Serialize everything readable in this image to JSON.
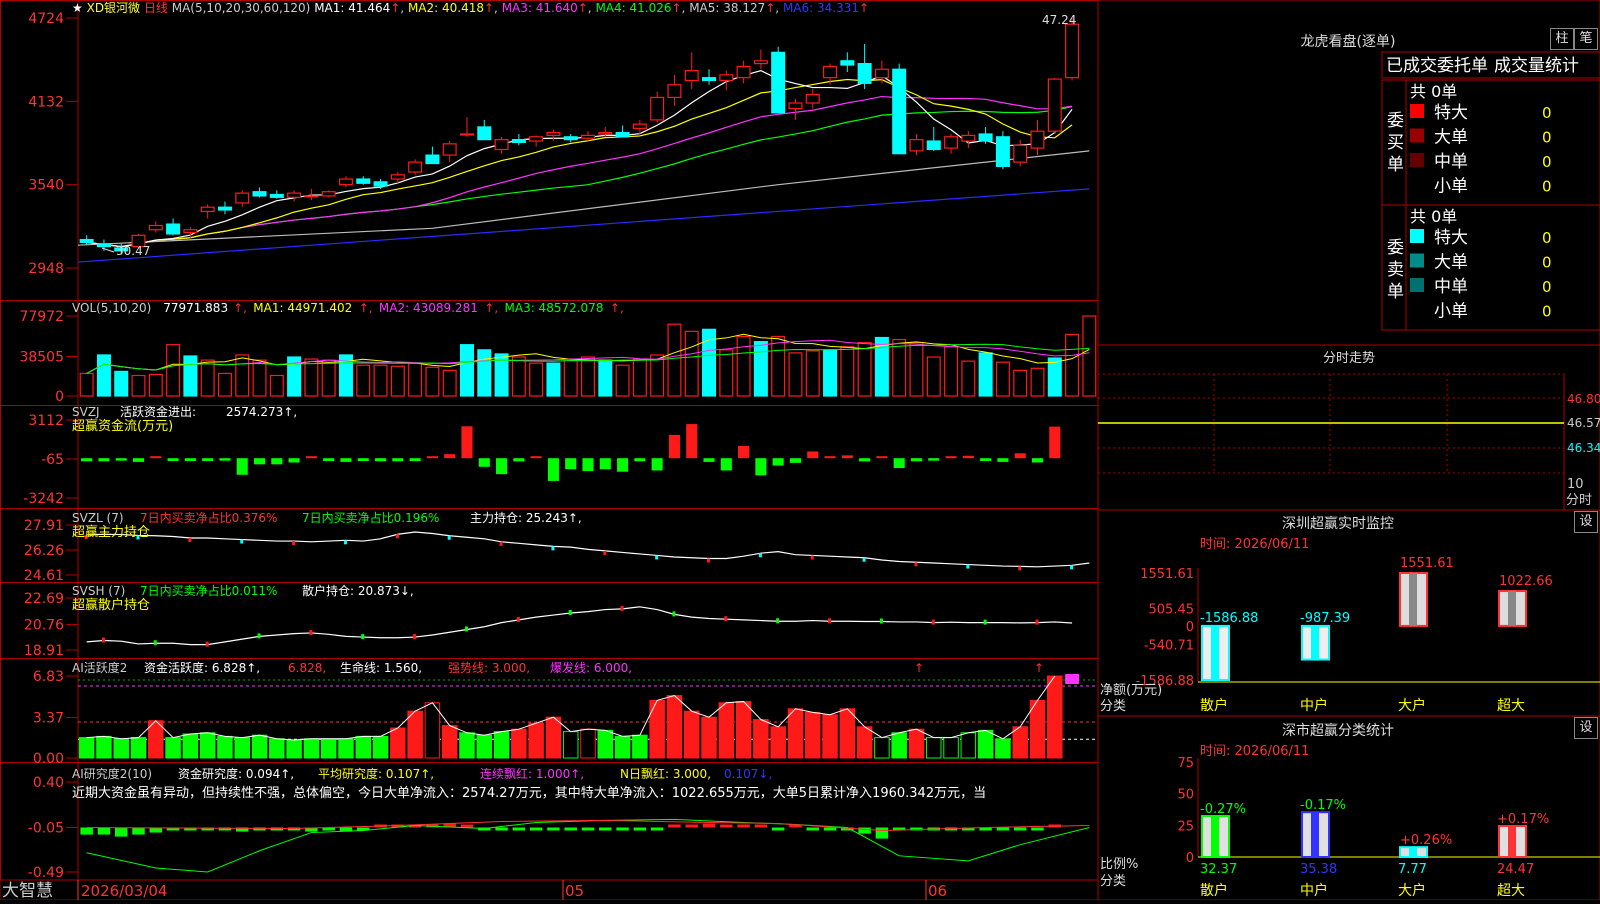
{
  "colors": {
    "up": "#ff1a1a",
    "down": "#00ffff",
    "green": "#00ff00",
    "ma1": "#ffffff",
    "ma2": "#ffff00",
    "ma3": "#ff33ff",
    "ma4": "#00ff00",
    "ma5": "#bbbbbb",
    "ma6": "#2b2bff",
    "frame": "#b00000"
  },
  "header": {
    "star": "★",
    "name": "XD银河微",
    "period": "日线",
    "ma_params": "MA(5,10,20,30,60,120)",
    "ma_items": [
      {
        "label": "MA1: 41.464",
        "arrow": "↑"
      },
      {
        "label": "MA2: 40.418",
        "arrow": "↑"
      },
      {
        "label": "MA3: 41.640",
        "arrow": "↑"
      },
      {
        "label": "MA4: 41.026",
        "arrow": "↑"
      },
      {
        "label": "MA5: 38.127",
        "arrow": "↑"
      },
      {
        "label": "MA6: 34.331",
        "arrow": "↑"
      }
    ]
  },
  "price_panel": {
    "y_ticks": [
      "4724",
      "4132",
      "3540",
      "2948"
    ],
    "high_label": "47.24",
    "low_label": "30.47"
  },
  "vol_panel": {
    "title": "VOL(5,10,20)",
    "value": "77971.883",
    "ma1": "MA1: 44971.402",
    "ma2": "MA2: 43089.281",
    "ma3": "MA3: 48572.078",
    "y_ticks": [
      "77972",
      "38505",
      "0"
    ]
  },
  "svzj_panel": {
    "title": "SVZJ",
    "label": "活跃资金进出:",
    "value": "2574.273",
    "subtitle": "超赢资金流(万元)",
    "y_ticks": [
      "3112",
      "-65",
      "-3242"
    ]
  },
  "svzl_panel": {
    "title": "SVZL (7)",
    "t1": "7日内买卖净占比0.376%",
    "t2": "7日内买卖净占比0.196%",
    "t3": "主力持仓: 25.243",
    "subtitle": "超赢主力持仓",
    "y_ticks": [
      "27.91",
      "26.26",
      "24.61"
    ]
  },
  "svsh_panel": {
    "title": "SVSH (7)",
    "t1": "7日内买卖净占比0.011%",
    "t2": "散户持仓: 20.873",
    "subtitle": "超赢散户持仓",
    "y_ticks": [
      "22.69",
      "20.76",
      "18.91"
    ]
  },
  "ai_active_panel": {
    "title": "AI活跃度2",
    "t1": "资金活跃度: 6.828",
    "t2": "6.828",
    "t3": "生命线: 1.560,",
    "t4": "强势线: 3.000,",
    "t5": "爆发线: 6.000,",
    "y_ticks": [
      "6.83",
      "3.37",
      "0.00"
    ]
  },
  "ai_research_panel": {
    "title": "AI研究度2(10)",
    "t1": "资金研究度: 0.094",
    "t2": "平均研究度: 0.107",
    "t3": "连续飘红: 1.000",
    "t4": "N日飘红: 3.000,",
    "t5": "0.107",
    "comment": "近期大资金虽有异动，但持续性不强，总体偏空，今日大单净流入：2574.27万元，其中特大单净流入：1022.655万元，大单5日累计净入1960.342万元，当",
    "y_ticks": [
      "0.40",
      "-0.05",
      "-0.49"
    ]
  },
  "bottom_bar": {
    "brand": "大智慧",
    "dates": [
      "2026/03/04",
      "05",
      "06"
    ]
  },
  "lhb": {
    "title": "龙虎看盘(逐单)",
    "btn_zhu": "柱",
    "btn_bi": "笔",
    "headers": [
      "已成交委托单",
      "成交量统计"
    ],
    "buy": {
      "side": "委买单",
      "total": "共 0单",
      "rows": [
        {
          "label": "特大",
          "value": "0"
        },
        {
          "label": "大单",
          "value": "0"
        },
        {
          "label": "中单",
          "value": "0"
        },
        {
          "label": "小单",
          "value": "0"
        }
      ]
    },
    "sell": {
      "side": "委卖单",
      "total": "共 0单",
      "rows": [
        {
          "label": "特大",
          "value": "0"
        },
        {
          "label": "大单",
          "value": "0"
        },
        {
          "label": "中单",
          "value": "0"
        },
        {
          "label": "小单",
          "value": "0"
        }
      ]
    }
  },
  "fenshi": {
    "title": "分时走势",
    "y_labels": [
      "46.80",
      "46.57",
      "46.34"
    ],
    "x_label": "10",
    "x_unit": "分时"
  },
  "monitor": {
    "title": "深圳超赢实时监控",
    "btn": "设",
    "time": "时间: 2026/06/11",
    "y_ticks": [
      "1551.61",
      "505.45",
      "0",
      "-540.71",
      "-1586.88"
    ],
    "ylabel": "净额(万元)",
    "xlabel": "分类"
  },
  "classify": {
    "title": "深市超赢分类统计",
    "btn": "设",
    "time": "时间: 2026/06/11",
    "y_ticks": [
      "75",
      "50",
      "25",
      "0"
    ],
    "ylabel": "比例%",
    "xlabel": "分类"
  },
  "chart_data": [
    {
      "type": "bar",
      "title": "深圳超赢实时监控",
      "categories": [
        "散户",
        "中户",
        "大户",
        "超大"
      ],
      "values": [
        -1586.88,
        -987.39,
        1551.61,
        1022.66
      ],
      "ylabel": "净额(万元)",
      "xlabel": "分类",
      "ylim": [
        -1586.88,
        1551.61
      ]
    },
    {
      "type": "bar",
      "title": "深市超赢分类统计",
      "categories": [
        "散户",
        "中户",
        "大户",
        "超大"
      ],
      "values": [
        32.37,
        35.38,
        7.77,
        24.47
      ],
      "changes": [
        "-0.27%",
        "-0.17%",
        "+0.26%",
        "+0.17%"
      ],
      "ylabel": "比例%",
      "xlabel": "分类",
      "ylim": [
        0,
        75
      ]
    },
    {
      "type": "candlestick",
      "title": "XD银河微 日线",
      "ylim": [
        29.48,
        47.24
      ],
      "ohlc": [
        [
          31.5,
          31.8,
          31.1,
          31.3
        ],
        [
          31.2,
          31.5,
          30.7,
          31.0
        ],
        [
          30.9,
          31.2,
          30.47,
          30.7
        ],
        [
          31.0,
          31.9,
          30.9,
          31.8
        ],
        [
          32.2,
          32.8,
          32.0,
          32.5
        ],
        [
          32.6,
          33.0,
          31.8,
          31.9
        ],
        [
          32.0,
          32.4,
          31.6,
          32.2
        ],
        [
          33.5,
          34.0,
          33.0,
          33.8
        ],
        [
          33.8,
          34.2,
          33.3,
          33.6
        ],
        [
          34.1,
          35.0,
          33.8,
          34.8
        ],
        [
          34.9,
          35.2,
          34.5,
          34.6
        ],
        [
          34.7,
          35.0,
          34.4,
          34.5
        ],
        [
          34.5,
          35.0,
          34.2,
          34.8
        ],
        [
          34.6,
          35.1,
          34.3,
          34.6
        ],
        [
          34.6,
          35.0,
          34.5,
          34.9
        ],
        [
          35.4,
          36.0,
          35.2,
          35.8
        ],
        [
          35.8,
          36.0,
          35.4,
          35.5
        ],
        [
          35.6,
          35.8,
          35.1,
          35.3
        ],
        [
          35.8,
          36.3,
          35.5,
          36.1
        ],
        [
          36.3,
          37.2,
          36.1,
          37.0
        ],
        [
          37.5,
          38.1,
          37.2,
          36.9
        ],
        [
          37.5,
          38.5,
          37.0,
          38.3
        ],
        [
          39.0,
          40.2,
          38.8,
          39.0
        ],
        [
          39.5,
          40.0,
          38.8,
          38.6
        ],
        [
          37.9,
          38.8,
          37.6,
          38.6
        ],
        [
          38.6,
          39.0,
          38.2,
          38.4
        ],
        [
          38.5,
          38.9,
          38.1,
          38.8
        ],
        [
          38.9,
          39.3,
          38.5,
          39.1
        ],
        [
          38.8,
          39.0,
          38.4,
          38.6
        ],
        [
          38.7,
          39.2,
          38.5,
          38.9
        ],
        [
          39.0,
          39.5,
          38.8,
          39.1
        ],
        [
          39.1,
          39.6,
          38.9,
          38.8
        ],
        [
          39.4,
          40.0,
          39.0,
          39.7
        ],
        [
          40.0,
          42.0,
          39.8,
          41.6
        ],
        [
          41.6,
          43.2,
          41.0,
          42.5
        ],
        [
          42.8,
          44.8,
          42.2,
          43.5
        ],
        [
          43.0,
          43.6,
          42.5,
          42.8
        ],
        [
          42.8,
          43.5,
          42.1,
          43.2
        ],
        [
          43.0,
          44.2,
          42.6,
          43.8
        ],
        [
          44.0,
          45.0,
          43.6,
          44.2
        ],
        [
          44.8,
          45.2,
          40.8,
          40.5
        ],
        [
          40.8,
          41.5,
          40.0,
          41.2
        ],
        [
          41.2,
          42.2,
          40.8,
          41.8
        ],
        [
          43.0,
          44.0,
          42.5,
          43.8
        ],
        [
          44.2,
          44.8,
          43.4,
          43.9
        ],
        [
          44.0,
          45.4,
          42.2,
          42.6
        ],
        [
          43.0,
          44.2,
          42.6,
          43.6
        ],
        [
          43.6,
          44.0,
          37.9,
          37.6
        ],
        [
          37.8,
          39.0,
          37.5,
          38.6
        ],
        [
          38.5,
          39.5,
          37.8,
          37.9
        ],
        [
          38.0,
          39.0,
          37.6,
          38.8
        ],
        [
          38.5,
          39.2,
          38.0,
          38.9
        ],
        [
          39.0,
          39.5,
          38.3,
          38.5
        ],
        [
          38.8,
          39.2,
          36.5,
          36.7
        ],
        [
          37.0,
          38.6,
          36.7,
          38.2
        ],
        [
          38.0,
          40.0,
          37.5,
          39.2
        ],
        [
          39.2,
          43.0,
          39.0,
          42.9
        ],
        [
          43.0,
          47.24,
          42.8,
          46.8
        ]
      ]
    },
    {
      "type": "bar",
      "title": "VOL(5,10,20)",
      "ylim": [
        0,
        77972
      ],
      "values": [
        22000,
        40000,
        24000,
        20000,
        21000,
        50000,
        39000,
        35000,
        22000,
        40000,
        35000,
        20000,
        38000,
        36000,
        35000,
        40000,
        30000,
        30000,
        29000,
        32000,
        28000,
        25000,
        50000,
        45000,
        41000,
        38000,
        32000,
        32000,
        36000,
        38000,
        35000,
        30000,
        36000,
        40000,
        70000,
        63000,
        65000,
        45000,
        58000,
        53000,
        58000,
        42000,
        44000,
        45000,
        48000,
        52000,
        57000,
        55000,
        52000,
        38000,
        48000,
        34000,
        42000,
        33000,
        25000,
        27000,
        37000,
        60000,
        77972
      ],
      "down": [
        false,
        true,
        true,
        false,
        false,
        false,
        true,
        false,
        false,
        false,
        false,
        false,
        true,
        false,
        false,
        true,
        false,
        false,
        false,
        false,
        false,
        false,
        true,
        true,
        true,
        false,
        false,
        true,
        false,
        false,
        true,
        false,
        false,
        false,
        false,
        false,
        true,
        false,
        false,
        true,
        false,
        false,
        false,
        true,
        false,
        false,
        true,
        false,
        false,
        false,
        false,
        false,
        true,
        false,
        false,
        false,
        true,
        false,
        false
      ]
    },
    {
      "type": "bar",
      "title": "SVZJ",
      "ylim": [
        -3242,
        3112
      ],
      "values": [
        -250,
        -250,
        -200,
        -300,
        0,
        -230,
        -230,
        -230,
        -200,
        -1350,
        -500,
        -500,
        -350,
        0,
        -230,
        -300,
        -230,
        -250,
        -250,
        -230,
        130,
        330,
        2600,
        -700,
        -1300,
        -260,
        0,
        -1850,
        -900,
        -1050,
        -900,
        -1100,
        -250,
        -1000,
        1900,
        2780,
        -300,
        -1000,
        1000,
        -1400,
        -600,
        -380,
        550,
        0,
        230,
        -260,
        0,
        -800,
        -250,
        -200,
        0,
        200,
        -230,
        -300,
        400,
        -350,
        2574
      ]
    },
    {
      "type": "line",
      "title": "SVZL",
      "ylim": [
        24.61,
        27.91
      ],
      "values": [
        27.25,
        27.3,
        27.28,
        27.22,
        27.2,
        27.15,
        27.05,
        27.05,
        27.0,
        26.95,
        26.9,
        26.85,
        26.85,
        26.8,
        26.85,
        26.9,
        26.85,
        27.0,
        27.3,
        27.45,
        27.35,
        27.2,
        27.1,
        27.0,
        26.8,
        26.7,
        26.6,
        26.5,
        26.45,
        26.3,
        26.2,
        26.1,
        26.0,
        25.9,
        25.8,
        25.75,
        25.7,
        25.7,
        25.85,
        26.05,
        26.15,
        25.95,
        25.9,
        25.85,
        25.8,
        25.75,
        25.6,
        25.5,
        25.45,
        25.4,
        25.35,
        25.3,
        25.25,
        25.2,
        25.18,
        25.15,
        25.2,
        25.25,
        25.4
      ]
    },
    {
      "type": "line",
      "title": "SVSH",
      "ylim": [
        18.91,
        22.69
      ],
      "values": [
        19.5,
        19.6,
        19.55,
        19.35,
        19.4,
        19.4,
        19.3,
        19.3,
        19.5,
        19.7,
        19.9,
        20.0,
        20.1,
        20.15,
        20.05,
        19.9,
        19.85,
        19.8,
        19.8,
        19.85,
        20.0,
        20.2,
        20.4,
        20.6,
        20.9,
        21.1,
        21.3,
        21.45,
        21.6,
        21.7,
        21.85,
        21.9,
        22.05,
        21.85,
        21.5,
        21.3,
        21.2,
        21.15,
        21.1,
        21.05,
        21.0,
        21.0,
        21.05,
        21.0,
        21.0,
        20.98,
        20.98,
        20.95,
        20.95,
        20.9,
        20.93,
        20.9,
        20.9,
        20.9,
        20.88,
        20.9,
        20.95,
        20.873
      ]
    },
    {
      "type": "bar",
      "title": "AI活跃度2",
      "ylim": [
        0,
        6.83
      ],
      "values": [
        1.7,
        1.8,
        1.6,
        1.7,
        3.1,
        1.7,
        2.0,
        2.1,
        1.8,
        1.7,
        1.9,
        1.6,
        1.5,
        1.6,
        1.6,
        1.6,
        1.8,
        1.8,
        2.5,
        3.9,
        4.6,
        2.7,
        2.1,
        1.9,
        2.2,
        2.4,
        2.9,
        3.4,
        2.2,
        2.4,
        2.3,
        1.8,
        1.9,
        4.8,
        5.2,
        3.9,
        3.4,
        4.6,
        4.7,
        3.2,
        2.6,
        4.1,
        3.8,
        3.6,
        4.1,
        2.6,
        1.7,
        2.1,
        2.4,
        1.7,
        1.7,
        2.1,
        2.3,
        1.6,
        2.6,
        4.8,
        6.828
      ]
    },
    {
      "type": "bar",
      "title": "AI研究度2(10)",
      "ylim": [
        -0.49,
        0.4
      ],
      "values": [
        -0.12,
        -0.12,
        -0.14,
        -0.12,
        -0.1,
        -0.07,
        -0.05,
        -0.05,
        -0.07,
        -0.09,
        -0.07,
        -0.06,
        -0.05,
        -0.09,
        -0.07,
        -0.09,
        -0.06,
        -0.04,
        -0.03,
        -0.03,
        -0.03,
        -0.01,
        -0.03,
        -0.05,
        -0.05,
        -0.05,
        -0.05,
        -0.05,
        -0.05,
        -0.05,
        -0.05,
        -0.05,
        -0.05,
        -0.05,
        -0.02,
        -0.03,
        -0.01,
        -0.04,
        -0.03,
        -0.03,
        -0.05,
        -0.04,
        -0.05,
        -0.05,
        -0.05,
        -0.11,
        -0.16,
        -0.08,
        -0.07,
        -0.05,
        -0.05,
        -0.05,
        -0.05,
        -0.06,
        -0.05,
        -0.05,
        -0.02
      ]
    }
  ]
}
